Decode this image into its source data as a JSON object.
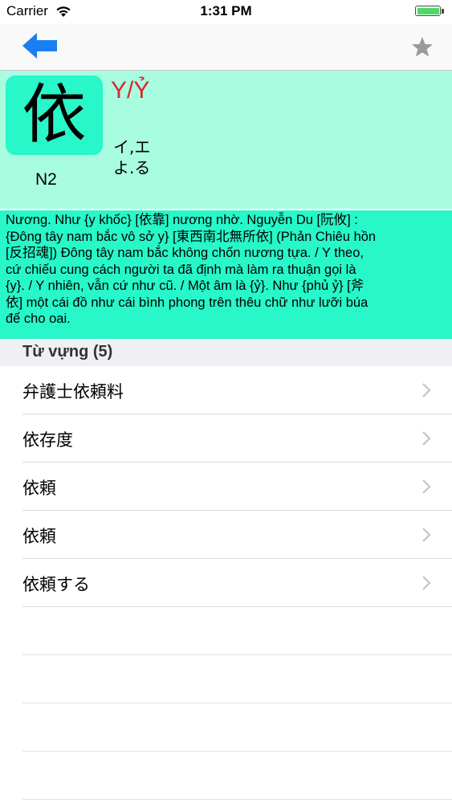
{
  "status_bar": {
    "carrier": "Carrier",
    "time": "1:31 PM"
  },
  "nav": {
    "back_icon": "arrow-left-icon",
    "favorite_icon": "star-icon",
    "accent_color": "#1a7ff2"
  },
  "kanji": {
    "character": "依",
    "jlpt": "N2",
    "hanviet": "Y/Ỷ",
    "onyomi": "イ,エ",
    "kunyomi": "よ.る"
  },
  "meaning": {
    "lines": [
      "Nương. Như {y khốc} [依靠] nương nhờ. Nguyễn Du [阮攸] :",
      "{Đông tây nam bắc vô sở y} [東西南北無所依] (Phản Chiêu hồn",
      "[反招魂]) Đông tây nam bắc không chốn nương tựa. / Y theo,",
      "cứ chiếu cung cách người ta đã định mà làm ra thuận gọi là",
      "{y}. / Y nhiên, vẫn cứ như cũ. / Một âm là {ỷ}. Như {phủ ỷ} [斧",
      "依] một cái đồ như cái bình phong trên thêu chữ như lưỡi búa",
      "để cho oai."
    ]
  },
  "vocab": {
    "header": "Từ vựng (5)",
    "items": [
      {
        "label": "弁護士依頼料"
      },
      {
        "label": "依存度"
      },
      {
        "label": "依頼"
      },
      {
        "label": "依頼"
      },
      {
        "label": "依頼する"
      }
    ]
  }
}
